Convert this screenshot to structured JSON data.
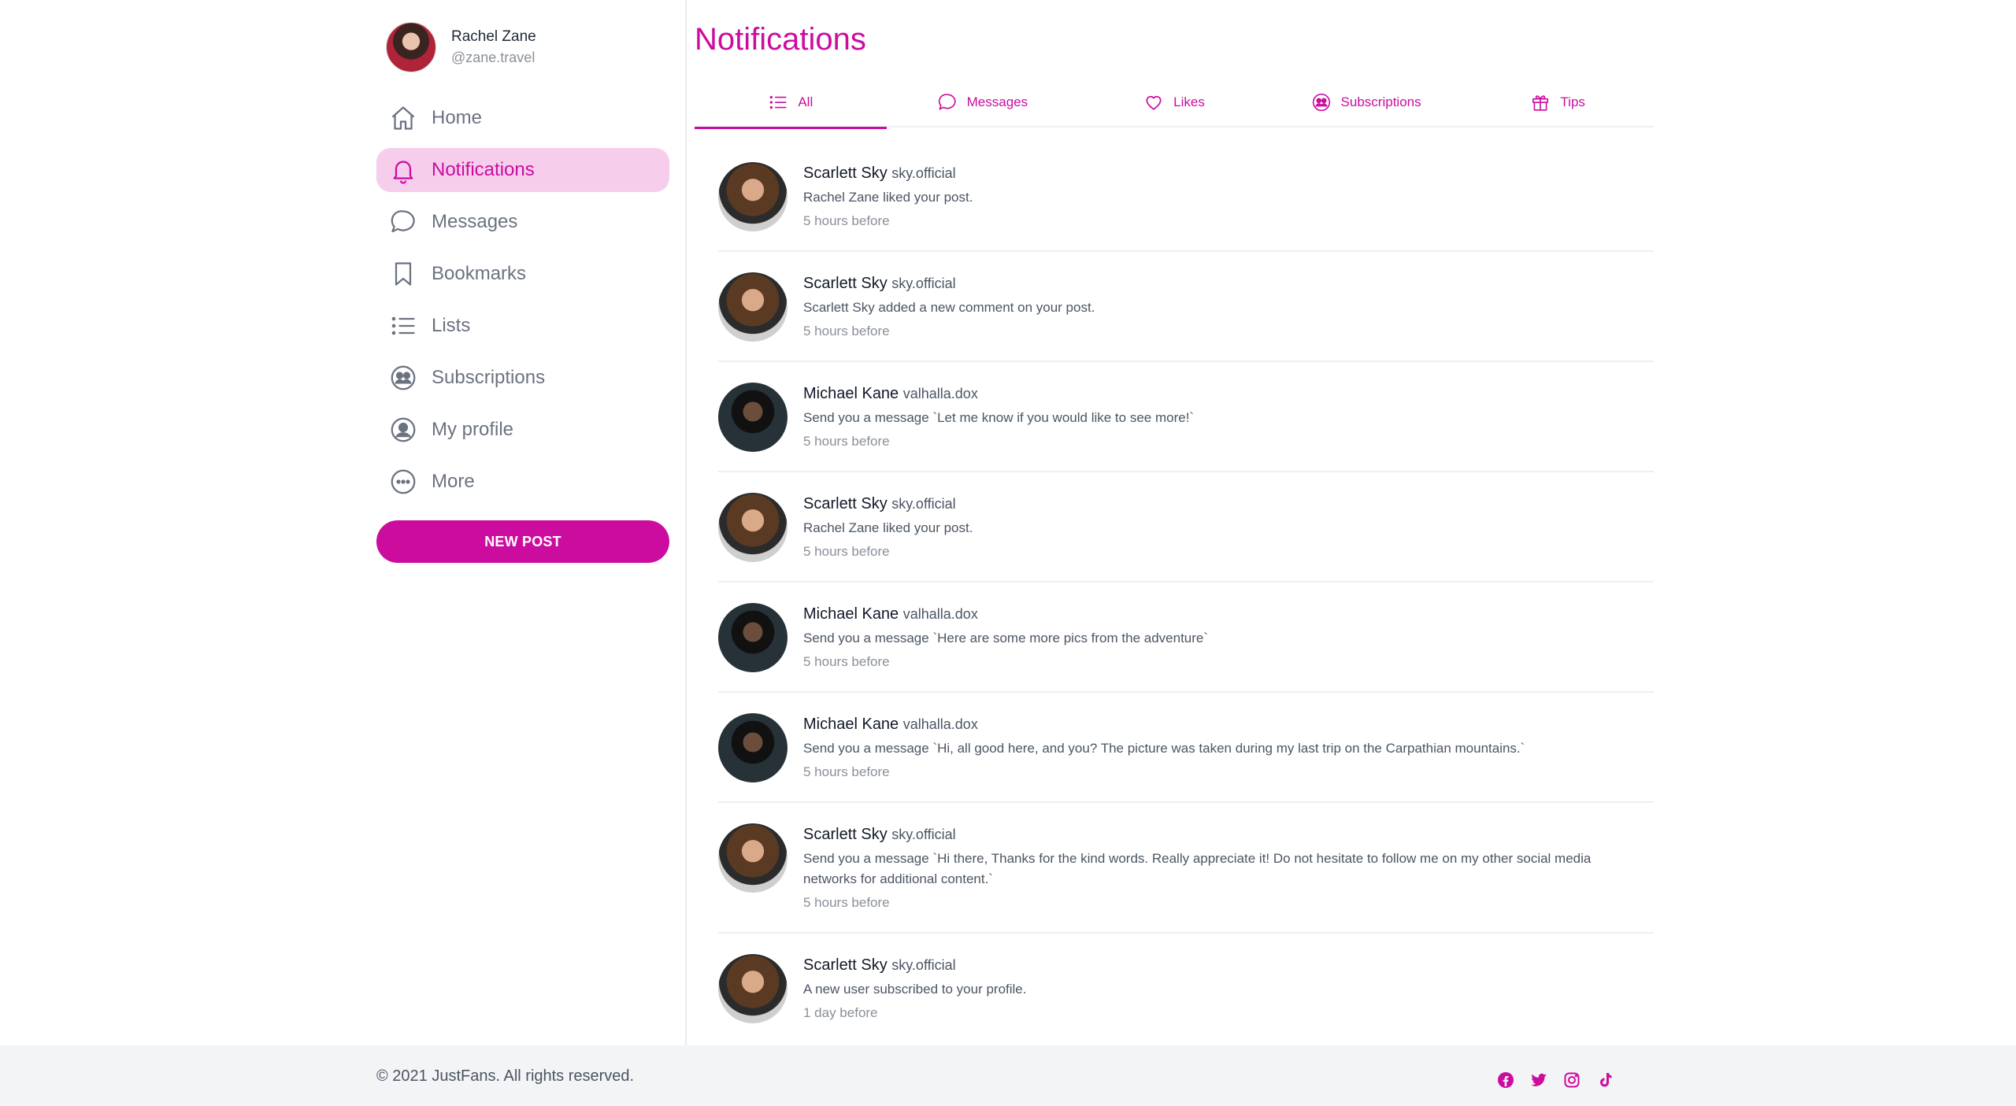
{
  "user": {
    "name": "Rachel Zane",
    "handle": "@zane.travel"
  },
  "nav": [
    {
      "label": "Home",
      "icon": "home-icon",
      "active": false
    },
    {
      "label": "Notifications",
      "icon": "bell-icon",
      "active": true
    },
    {
      "label": "Messages",
      "icon": "chat-icon",
      "active": false
    },
    {
      "label": "Bookmarks",
      "icon": "bookmark-icon",
      "active": false
    },
    {
      "label": "Lists",
      "icon": "list-icon",
      "active": false
    },
    {
      "label": "Subscriptions",
      "icon": "subscriptions-icon",
      "active": false
    },
    {
      "label": "My profile",
      "icon": "profile-icon",
      "active": false
    },
    {
      "label": "More",
      "icon": "more-icon",
      "active": false
    }
  ],
  "new_post_label": "NEW POST",
  "page_title": "Notifications",
  "tabs": [
    {
      "label": "All",
      "icon": "list-icon",
      "active": true
    },
    {
      "label": "Messages",
      "icon": "chat-icon",
      "active": false
    },
    {
      "label": "Likes",
      "icon": "heart-icon",
      "active": false
    },
    {
      "label": "Subscriptions",
      "icon": "subscriptions-icon",
      "active": false
    },
    {
      "label": "Tips",
      "icon": "gift-icon",
      "active": false
    }
  ],
  "notifications": [
    {
      "name": "Scarlett Sky",
      "handle": "sky.official",
      "avatar": "scarlett",
      "message": "Rachel Zane liked your post.",
      "time": "5 hours before"
    },
    {
      "name": "Scarlett Sky",
      "handle": "sky.official",
      "avatar": "scarlett",
      "message": "Scarlett Sky added a new comment on your post.",
      "time": "5 hours before"
    },
    {
      "name": "Michael Kane",
      "handle": "valhalla.dox",
      "avatar": "michael",
      "message": "Send you a message `Let me know if you would like to see more!`",
      "time": "5 hours before"
    },
    {
      "name": "Scarlett Sky",
      "handle": "sky.official",
      "avatar": "scarlett",
      "message": "Rachel Zane liked your post.",
      "time": "5 hours before"
    },
    {
      "name": "Michael Kane",
      "handle": "valhalla.dox",
      "avatar": "michael",
      "message": "Send you a message `Here are some more pics from the adventure`",
      "time": "5 hours before"
    },
    {
      "name": "Michael Kane",
      "handle": "valhalla.dox",
      "avatar": "michael",
      "message": "Send you a message `Hi, all good here, and you? The picture was taken during my last trip on the Carpathian mountains.`",
      "time": "5 hours before"
    },
    {
      "name": "Scarlett Sky",
      "handle": "sky.official",
      "avatar": "scarlett",
      "message": "Send you a message `Hi there, Thanks for the kind words. Really appreciate it! Do not hesitate to follow me on my other social media networks for additional content.`",
      "time": "5 hours before"
    },
    {
      "name": "Scarlett Sky",
      "handle": "sky.official",
      "avatar": "scarlett",
      "message": "A new user subscribed to your profile.",
      "time": "1 day before"
    }
  ],
  "footer": {
    "copyright": "© 2021 JustFans. All rights reserved.",
    "socials": [
      "facebook-icon",
      "twitter-icon",
      "instagram-icon",
      "tiktok-icon"
    ]
  },
  "colors": {
    "accent": "#cb0c9f",
    "active_bg": "#f7cdec",
    "muted": "#6b7280",
    "footer_bg": "#f3f4f6"
  }
}
